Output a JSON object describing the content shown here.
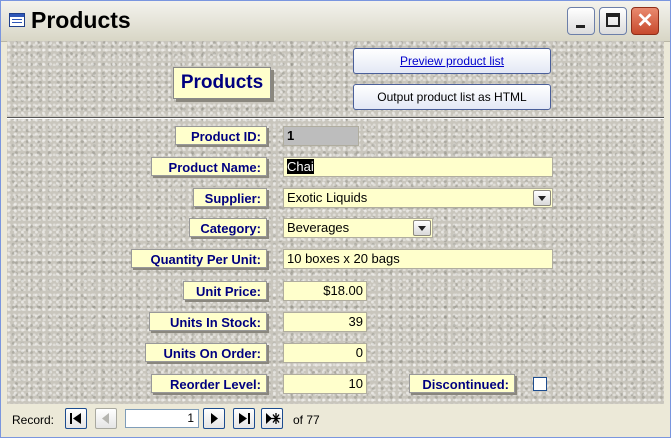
{
  "window": {
    "title": "Products"
  },
  "header": {
    "title": "Products",
    "preview_button": "Preview product list",
    "output_button": "Output product list as HTML"
  },
  "fields": {
    "product_id": {
      "label": "Product ID:",
      "value": "1"
    },
    "product_name": {
      "label": "Product Name:",
      "value": "Chai"
    },
    "supplier": {
      "label": "Supplier:",
      "value": "Exotic Liquids"
    },
    "category": {
      "label": "Category:",
      "value": "Beverages"
    },
    "quantity_per_unit": {
      "label": "Quantity Per Unit:",
      "value": "10 boxes x 20 bags"
    },
    "unit_price": {
      "label": "Unit Price:",
      "value": "$18.00"
    },
    "units_in_stock": {
      "label": "Units In Stock:",
      "value": "39"
    },
    "units_on_order": {
      "label": "Units On Order:",
      "value": "0"
    },
    "reorder_level": {
      "label": "Reorder Level:",
      "value": "10"
    },
    "discontinued": {
      "label": "Discontinued:",
      "checked": false
    }
  },
  "navigation": {
    "record_label": "Record:",
    "current_record": "1",
    "of_label": "of",
    "total_records": "77"
  },
  "icons": {
    "window_icon": "form-icon",
    "first": "first-record-icon",
    "prev": "previous-record-icon",
    "next": "next-record-icon",
    "last": "last-record-icon",
    "new": "new-record-icon"
  }
}
